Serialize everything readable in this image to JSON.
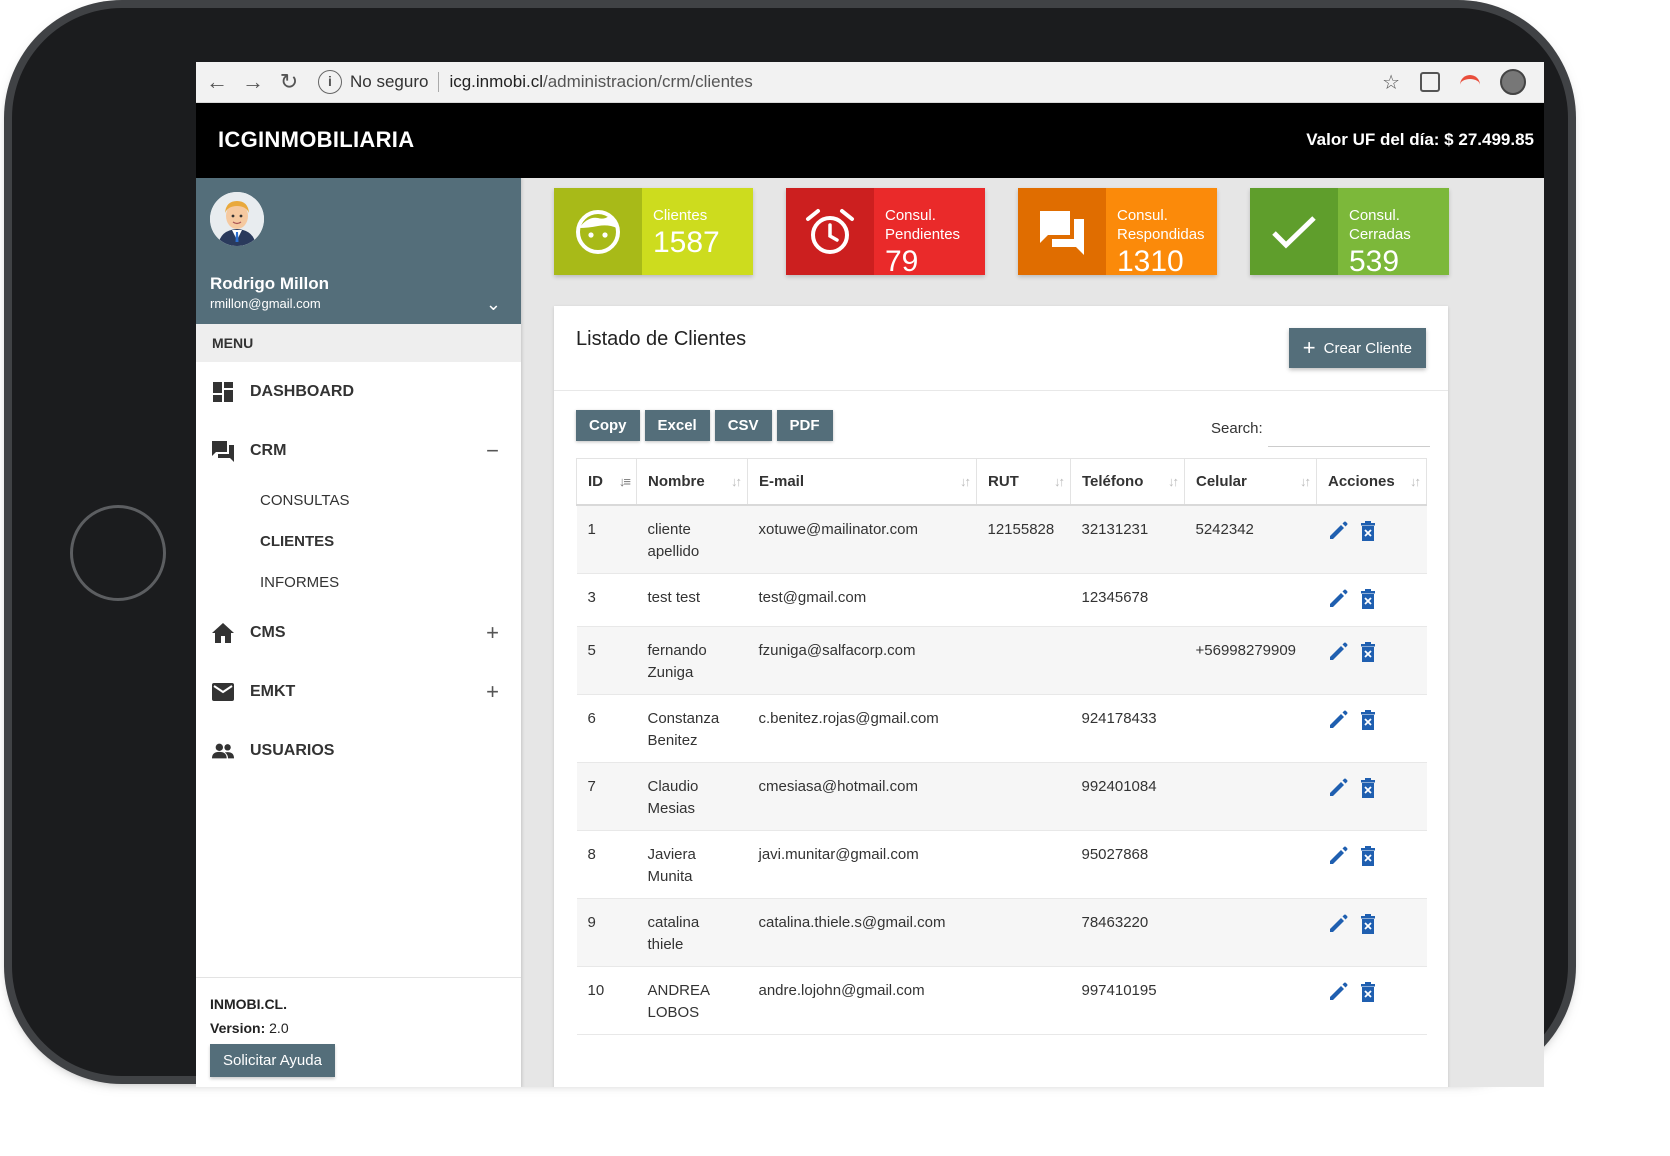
{
  "browser": {
    "security_label": "No seguro",
    "url_host": "icg.inmobi.cl",
    "url_path": "/administracion/crm/clientes"
  },
  "header": {
    "brand": "ICGINMOBILIARIA",
    "uf_label": "Valor UF del día: $ 27.499.85"
  },
  "profile": {
    "name": "Rodrigo Millon",
    "email": "rmillon@gmail.com"
  },
  "menu": {
    "heading": "MENU",
    "dashboard": "DASHBOARD",
    "crm": "CRM",
    "crm_sub": [
      "CONSULTAS",
      "CLIENTES",
      "INFORMES"
    ],
    "cms": "CMS",
    "emkt": "EMKT",
    "usuarios": "USUARIOS"
  },
  "footer": {
    "site": "INMOBI.CL.",
    "version_label": "Version:",
    "version_value": "2.0",
    "help_button": "Solicitar Ayuda"
  },
  "stats": [
    {
      "label": "Clientes",
      "value": "1587",
      "color_dark": "#a8ba18",
      "color_light": "#cddc1e",
      "icon": "face-icon"
    },
    {
      "label": "Consul. Pendientes",
      "value": "79",
      "color_dark": "#cc1f1f",
      "color_light": "#ea2a2a",
      "icon": "alarm-icon"
    },
    {
      "label": "Consul. Respondidas",
      "value": "1310",
      "color_dark": "#e06d00",
      "color_light": "#fb8a0a",
      "icon": "forum-icon"
    },
    {
      "label": "Consul. Cerradas",
      "value": "539",
      "color_dark": "#5f9e2c",
      "color_light": "#7cb83a",
      "icon": "check-icon"
    }
  ],
  "card": {
    "title": "Listado de Clientes",
    "create_button": "Crear Cliente",
    "export_buttons": [
      "Copy",
      "Excel",
      "CSV",
      "PDF"
    ],
    "search_label": "Search:"
  },
  "table": {
    "columns": [
      "ID",
      "Nombre",
      "E-mail",
      "RUT",
      "Teléfono",
      "Celular",
      "Acciones"
    ],
    "rows": [
      {
        "id": "1",
        "nombre": "cliente apellido",
        "email": "xotuwe@mailinator.com",
        "rut": "12155828",
        "telefono": "32131231",
        "celular": "5242342"
      },
      {
        "id": "3",
        "nombre": "test test",
        "email": "test@gmail.com",
        "rut": "",
        "telefono": "12345678",
        "celular": ""
      },
      {
        "id": "5",
        "nombre": "fernando Zuniga",
        "email": "fzuniga@salfacorp.com",
        "rut": "",
        "telefono": "",
        "celular": "+56998279909"
      },
      {
        "id": "6",
        "nombre": "Constanza Benitez",
        "email": "c.benitez.rojas@gmail.com",
        "rut": "",
        "telefono": "924178433",
        "celular": ""
      },
      {
        "id": "7",
        "nombre": "Claudio Mesias",
        "email": "cmesiasa@hotmail.com",
        "rut": "",
        "telefono": "992401084",
        "celular": ""
      },
      {
        "id": "8",
        "nombre": "Javiera Munita",
        "email": "javi.munitar@gmail.com",
        "rut": "",
        "telefono": "95027868",
        "celular": ""
      },
      {
        "id": "9",
        "nombre": "catalina thiele",
        "email": "catalina.thiele.s@gmail.com",
        "rut": "",
        "telefono": "78463220",
        "celular": ""
      },
      {
        "id": "10",
        "nombre": "ANDREA LOBOS",
        "email": "andre.lojohn@gmail.com",
        "rut": "",
        "telefono": "997410195",
        "celular": ""
      }
    ]
  },
  "colors": {
    "primary": "#546e7a",
    "link": "#2d6bb6",
    "action_icon": "#1f5fb0"
  }
}
